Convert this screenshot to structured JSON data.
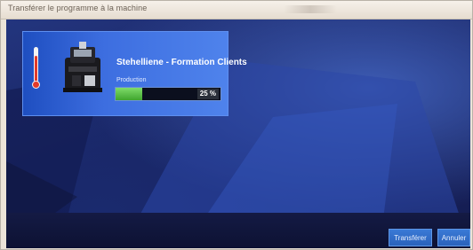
{
  "window": {
    "title": "Transférer le programme à la machine"
  },
  "job": {
    "name": "Stehelliene - Formation Clients",
    "status_label": "Production",
    "progress_percent": 25,
    "progress_text": "25 %",
    "icons": [
      "thermometer-icon",
      "machine-icon"
    ]
  },
  "footer": {
    "transfer_label": "Transférer",
    "cancel_label": "Annuler"
  },
  "colors": {
    "card": "#3d6ee0",
    "progress_fill": "#4fbf3c",
    "button": "#2a62bb",
    "background": "#1a2563"
  }
}
